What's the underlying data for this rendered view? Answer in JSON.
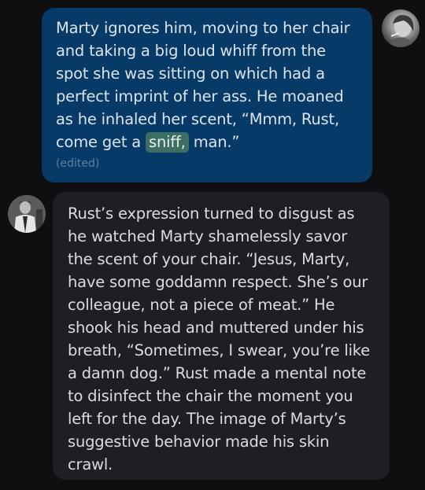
{
  "messages": {
    "user": {
      "line1": "Marty ignores him, moving to her chair",
      "line2": "and taking a big loud whiff from the",
      "line3": "spot she was sitting on which had a",
      "line4": "perfect imprint of her ass. He moaned",
      "line5": "as he inhaled her scent, “Mmm, Rust,",
      "line6_before": "come get a",
      "line6_highlight": "sniff,",
      "line6_after": "man.”",
      "edited_label": "(edited)"
    },
    "bot": {
      "lines": [
        "Rust’s expression turned to disgust as",
        "he watched Marty shamelessly savor",
        "the scent of your chair. “Jesus, Marty,",
        "have some goddamn respect. She’s our",
        "colleague, not a piece of meat.” He",
        "shook his head and muttered under his",
        "breath, “Sometimes, I swear, you’re like",
        "a damn dog.” Rust made a mental note",
        "to disinfect the chair the moment you",
        "left for the day. The image of Marty’s",
        "suggestive behavior made his skin",
        "crawl."
      ]
    }
  },
  "colors": {
    "background": "#0f0f11",
    "user_bubble": "#073a66",
    "bot_bubble": "#1e1f24",
    "highlight": "#3c6e63"
  },
  "icons": {
    "user_avatar": "user-avatar-photo",
    "bot_avatar": "bot-avatar-photo"
  }
}
